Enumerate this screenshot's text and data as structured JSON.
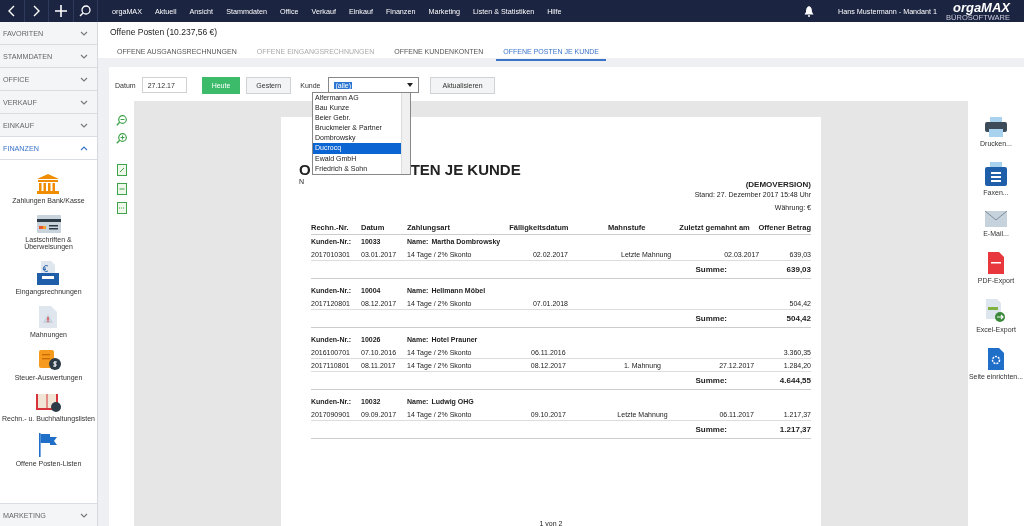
{
  "topbar": {
    "menu": [
      {
        "label": "orgaMAX"
      },
      {
        "label": "Aktuell"
      },
      {
        "label": "Ansicht"
      },
      {
        "label": "Stammdaten"
      },
      {
        "label": "Office"
      },
      {
        "label": "Verkauf"
      },
      {
        "label": "Einkauf"
      },
      {
        "label": "Finanzen"
      },
      {
        "label": "Marketing"
      },
      {
        "label": "Listen & Statistiken"
      },
      {
        "label": "Hilfe"
      }
    ],
    "user": "Hans Mustermann - Mandant 1",
    "logo": "orgaMAX",
    "logo_tagline": "BÜROSOFTWARE"
  },
  "sidebar": {
    "sections": [
      {
        "label": "FAVORITEN",
        "expanded": false
      },
      {
        "label": "STAMMDATEN",
        "expanded": false
      },
      {
        "label": "OFFICE",
        "expanded": false
      },
      {
        "label": "VERKAUF",
        "expanded": false
      },
      {
        "label": "EINKAUF",
        "expanded": false
      },
      {
        "label": "FINANZEN",
        "expanded": true,
        "items": [
          {
            "label": "Zahlungen Bank/Kasse"
          },
          {
            "label": "Lastschriften & Überweisungen"
          },
          {
            "label": "Eingangsrechnungen"
          },
          {
            "label": "Mahnungen"
          },
          {
            "label": "Steuer-Auswertungen"
          },
          {
            "label": "Rechn.- u. Buchhaltungslisten"
          },
          {
            "label": "Offene Posten-Listen"
          }
        ]
      }
    ],
    "bottom_section": {
      "label": "MARKETING",
      "expanded": false
    }
  },
  "header": {
    "title": "Offene Posten (10.237,56 €)",
    "tabs": [
      {
        "label": "OFFENE AUSGANGSRECHNUNGEN",
        "selected": false,
        "disabled": false
      },
      {
        "label": "OFFENE EINGANGSRECHNUNGEN",
        "selected": false,
        "disabled": true
      },
      {
        "label": "OFFENE KUNDENKONTEN",
        "selected": false,
        "disabled": false
      },
      {
        "label": "OFFENE POSTEN JE KUNDE",
        "selected": true,
        "disabled": false
      }
    ]
  },
  "toolbar": {
    "date_label": "Datum",
    "date_value": "27.12.17",
    "buttons": [
      {
        "label": "Heute",
        "kind": "primary"
      },
      {
        "label": "Gestern",
        "kind": "default"
      }
    ],
    "customer_label": "Kunde",
    "customer_value": "(alle)",
    "customer_options": [
      {
        "label": "Alfermann AG",
        "selected": false
      },
      {
        "label": "Bau Kunze",
        "selected": false
      },
      {
        "label": "Beier Gebr.",
        "selected": false
      },
      {
        "label": "Bruckmeier & Partner",
        "selected": false
      },
      {
        "label": "Dombrowsky",
        "selected": false
      },
      {
        "label": "Ducrocq",
        "selected": true
      },
      {
        "label": "Ewald GmbH",
        "selected": false
      },
      {
        "label": "Friedrich & Sohn",
        "selected": false
      }
    ],
    "refresh_button": "Aktualisieren"
  },
  "report": {
    "title_parts": [
      "O",
      "TEN JE KUNDE"
    ],
    "subtitle": "N",
    "demo": "(DEMOVERSION)",
    "stand": "Stand:  27. Dezember 2017 15:48 Uhr",
    "currency": "Währung: €",
    "columns": [
      "Rechn.-Nr.",
      "Datum",
      "Zahlungsart",
      "Fälligkeitsdatum",
      "Mahnstufe",
      "Zuletzt gemahnt am",
      "Offener Betrag"
    ],
    "groups": [
      {
        "customer_label": "Kunden-Nr.:",
        "customer_no": "10033",
        "name_label": "Name:",
        "name": "Martha Dombrowsky",
        "rows": [
          [
            "2017010301",
            "03.01.2017",
            "14 Tage / 2% Skonto",
            "02.02.2017",
            "Letzte Mahnung",
            "02.03.2017",
            "639,03"
          ]
        ],
        "sum_label": "Summe:",
        "sum": "639,03"
      },
      {
        "customer_label": "Kunden-Nr.:",
        "customer_no": "10004",
        "name_label": "Name:",
        "name": "Hellmann Möbel",
        "rows": [
          [
            "2017120801",
            "08.12.2017",
            "14 Tage / 2% Skonto",
            "07.01.2018",
            "",
            "",
            "504,42"
          ]
        ],
        "sum_label": "Summe:",
        "sum": "504,42"
      },
      {
        "customer_label": "Kunden-Nr.:",
        "customer_no": "10026",
        "name_label": "Name:",
        "name": "Hotel Prauner",
        "rows": [
          [
            "2016100701",
            "07.10.2016",
            "14 Tage / 2% Skonto",
            "06.11.2016",
            "",
            "",
            "3.360,35"
          ],
          [
            "2017110801",
            "08.11.2017",
            "14 Tage / 2% Skonto",
            "08.12.2017",
            "1. Mahnung",
            "27.12.2017",
            "1.284,20"
          ]
        ],
        "sum_label": "Summe:",
        "sum": "4.644,55"
      },
      {
        "customer_label": "Kunden-Nr.:",
        "customer_no": "10032",
        "name_label": "Name:",
        "name": "Ludwig OHG",
        "rows": [
          [
            "2017090901",
            "09.09.2017",
            "14 Tage / 2% Skonto",
            "09.10.2017",
            "Letzte Mahnung",
            "06.11.2017",
            "1.217,37"
          ]
        ],
        "sum_label": "Summe:",
        "sum": "1.217,37"
      }
    ],
    "page_info": "1 von 2"
  },
  "actions": [
    {
      "label": "Drucken..."
    },
    {
      "label": "Faxen..."
    },
    {
      "label": "E-Mail..."
    },
    {
      "label": "PDF-Export"
    },
    {
      "label": "Excel-Export"
    },
    {
      "label": "Seite einrichten..."
    }
  ]
}
